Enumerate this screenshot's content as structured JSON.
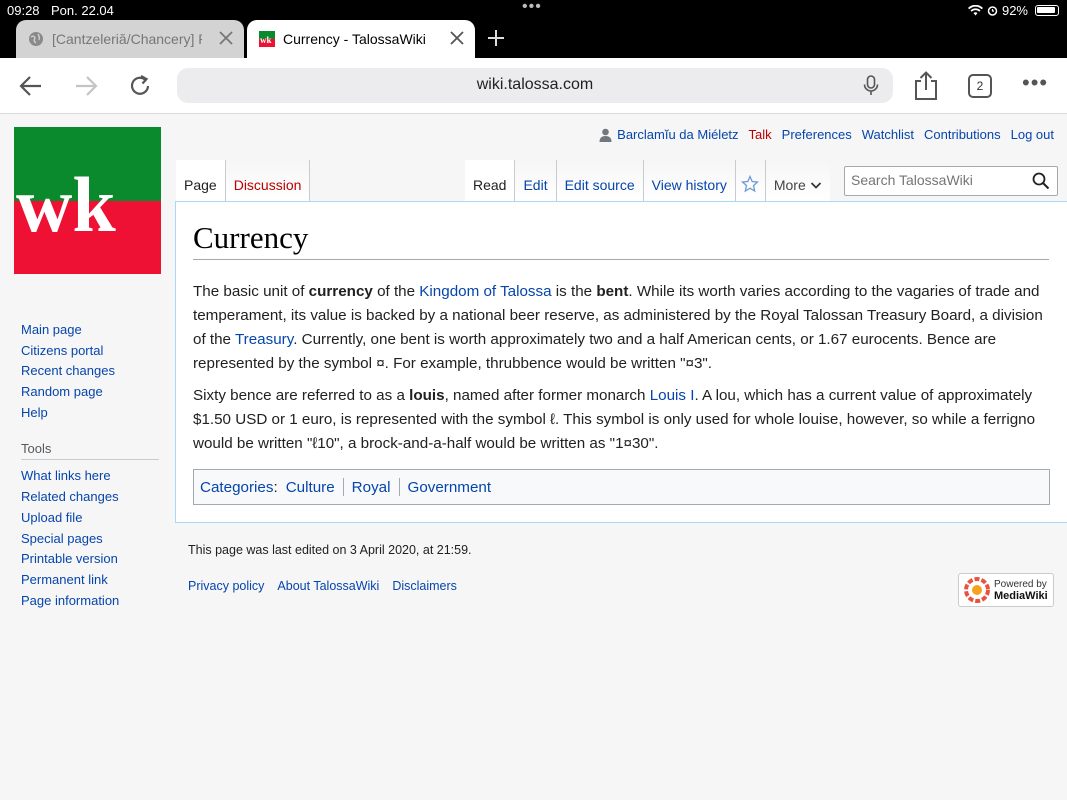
{
  "status_bar": {
    "time": "09:28",
    "date": "Pon. 22.04",
    "battery": "92%"
  },
  "browser": {
    "tabs": [
      {
        "title": "[Cantzeleriă/Chancery] P"
      },
      {
        "title": "Currency - TalossaWiki"
      }
    ],
    "url": "wiki.talossa.com",
    "tab_count": "2"
  },
  "logo": {
    "text": "wk",
    "colors": [
      "#0a8a2c",
      "#ffffff",
      "#ee1133"
    ]
  },
  "personal": {
    "username": "Barclamĭu da Miéletz",
    "talk": "Talk",
    "preferences": "Preferences",
    "watchlist": "Watchlist",
    "contributions": "Contributions",
    "logout": "Log out"
  },
  "namespaces": {
    "page": "Page",
    "discussion": "Discussion"
  },
  "views": {
    "read": "Read",
    "edit": "Edit",
    "edit_source": "Edit source",
    "history": "View history",
    "more": "More"
  },
  "search": {
    "placeholder": "Search TalossaWiki"
  },
  "article": {
    "title": "Currency",
    "p1": {
      "t1": "The basic unit of ",
      "b1": "currency",
      "t2": " of the ",
      "l1": "Kingdom of Talossa",
      "t3": " is the ",
      "b2": "bent",
      "t4": ". While its worth varies according to the vagaries of trade and temperament, its value is backed by a national beer reserve, as administered by the Royal Talossan Treasury Board, a division of the ",
      "l2": "Treasury",
      "t5": ". Currently, one bent is worth approximately two and a half American cents, or 1.67 eurocents. Bence are represented by the symbol ¤. For example, thrubbence would be written \"¤3\"."
    },
    "p2": {
      "t1": "Sixty bence are referred to as a ",
      "b1": "louis",
      "t2": ", named after former monarch ",
      "l1": "Louis I",
      "t3": ". A lou, which has a current value of approximately $1.50 USD or 1 euro, is represented with the symbol ℓ. This symbol is only used for whole louise, however, so while a ferrigno would be written \"ℓ10\", a brock-and-a-half would be written as \"1¤30\"."
    },
    "categories": {
      "label": "Categories",
      "items": [
        "Culture",
        "Royal",
        "Government"
      ]
    }
  },
  "sidebar": {
    "navigation": [
      "Main page",
      "Citizens portal",
      "Recent changes",
      "Random page",
      "Help"
    ],
    "tools_heading": "Tools",
    "tools": [
      "What links here",
      "Related changes",
      "Upload file",
      "Special pages",
      "Printable version",
      "Permanent link",
      "Page information"
    ]
  },
  "footer": {
    "last_modified": "This page was last edited on 3 April 2020, at 21:59.",
    "links": [
      "Privacy policy",
      "About TalossaWiki",
      "Disclaimers"
    ],
    "powered_by_line1": "Powered by",
    "powered_by_line2": "MediaWiki"
  }
}
